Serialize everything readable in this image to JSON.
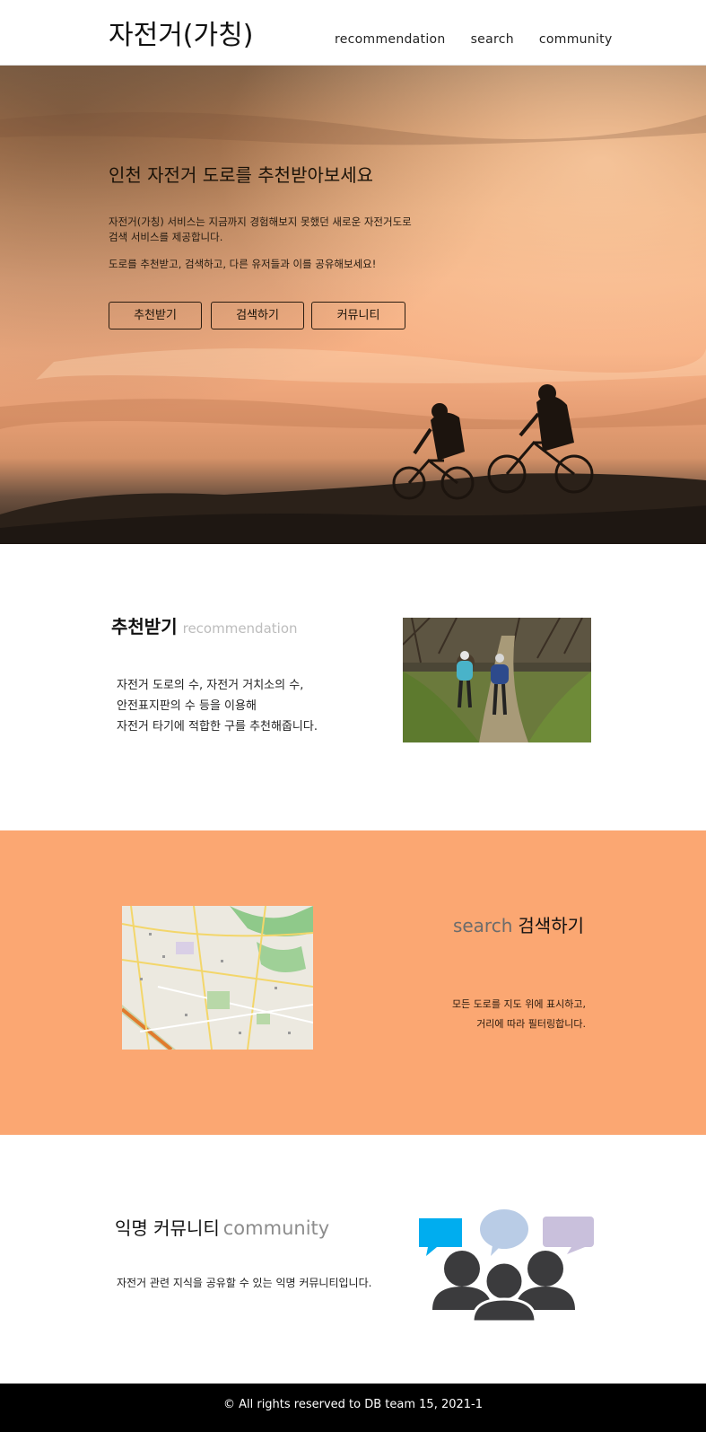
{
  "header": {
    "logo": "자전거(가칭)",
    "nav": [
      "recommendation",
      "search",
      "community"
    ]
  },
  "hero": {
    "title": "인천 자전거 도로를 추천받아보세요",
    "description": "자전거(가칭) 서비스는 지금까지 경험해보지 못했던 새로운 자전거도로 검색 서비스를 제공합니다.",
    "description2": "도로를 추천받고, 검색하고, 다른 유저들과 이를 공유해보세요!",
    "buttons": [
      "추천받기",
      "검색하기",
      "커뮤니티"
    ]
  },
  "recommendation": {
    "title": "추천받기",
    "subtitle": "recommendation",
    "lines": [
      "자전거 도로의 수, 자전거 거치소의 수,",
      "안전표지판의 수 등을 이용해",
      "자전거 타기에 적합한 구를 추천해줍니다."
    ]
  },
  "search": {
    "subtitle": "search",
    "title": "검색하기",
    "lines": [
      "모든 도로를 지도 위에 표시하고,",
      "거리에 따라 필터링합니다."
    ]
  },
  "community": {
    "title": "익명 커뮤니티",
    "subtitle": "community",
    "text": "자전거 관련 지식을 공유할 수 있는 익명 커뮤니티입니다."
  },
  "footer": {
    "text": "© All rights reserved to DB team 15, 2021-1"
  },
  "colors": {
    "accent": "#fba772",
    "footer_bg": "#000000"
  }
}
